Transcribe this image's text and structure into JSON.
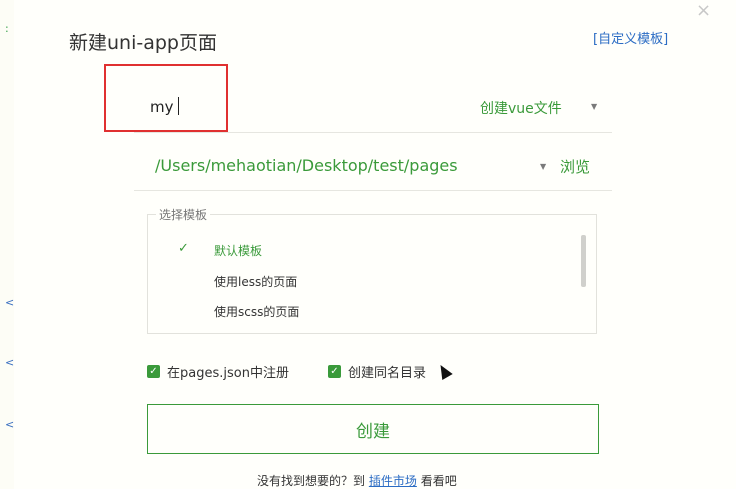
{
  "dialog": {
    "title": "新建uni-app页面",
    "custom_template_link": "[自定义模板]",
    "close_glyph": "×"
  },
  "name_field": {
    "value": "my",
    "file_type": "创建vue文件"
  },
  "path_field": {
    "value": "/Users/mehaotian/Desktop/test/pages",
    "browse_label": "浏览"
  },
  "templates": {
    "legend": "选择模板",
    "items": [
      {
        "label": "默认模板",
        "selected": true
      },
      {
        "label": "使用less的页面",
        "selected": false
      },
      {
        "label": "使用scss的页面",
        "selected": false
      }
    ],
    "check_glyph": "✓"
  },
  "options": {
    "register_label": "在pages.json中注册",
    "register_checked": true,
    "same_dir_label": "创建同名目录",
    "same_dir_checked": true
  },
  "actions": {
    "create_label": "创建"
  },
  "footer": {
    "prefix": "没有找到想要的？到",
    "link": "插件市场",
    "suffix": "看看吧"
  },
  "colors": {
    "accent_green": "#3a9a3a",
    "link_blue": "#2b6cc4",
    "highlight_red": "#e03030"
  }
}
